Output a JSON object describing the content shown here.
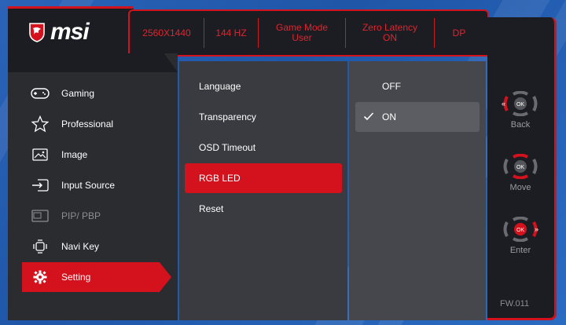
{
  "header": {
    "brand": "msi",
    "cells": [
      {
        "line1": "2560X1440",
        "line2": ""
      },
      {
        "line1": "144 HZ",
        "line2": ""
      },
      {
        "line1": "Game Mode",
        "line2": "User"
      },
      {
        "line1": "Zero Latency",
        "line2": "ON"
      },
      {
        "line1": "DP",
        "line2": ""
      }
    ]
  },
  "menu": {
    "items": [
      {
        "label": "Gaming",
        "icon": "gamepad-icon",
        "state": "normal"
      },
      {
        "label": "Professional",
        "icon": "star-icon",
        "state": "normal"
      },
      {
        "label": "Image",
        "icon": "image-icon",
        "state": "normal"
      },
      {
        "label": "Input Source",
        "icon": "input-source-icon",
        "state": "normal"
      },
      {
        "label": "PIP/ PBP",
        "icon": "pip-icon",
        "state": "disabled"
      },
      {
        "label": "Navi Key",
        "icon": "navi-key-icon",
        "state": "normal"
      },
      {
        "label": "Setting",
        "icon": "gear-icon",
        "state": "active"
      }
    ]
  },
  "submenu": {
    "items": [
      {
        "label": "Language",
        "active": false
      },
      {
        "label": "Transparency",
        "active": false
      },
      {
        "label": "OSD Timeout",
        "active": false
      },
      {
        "label": "RGB LED",
        "active": true
      },
      {
        "label": "Reset",
        "active": false
      }
    ]
  },
  "options": {
    "items": [
      {
        "label": "OFF",
        "selected": false
      },
      {
        "label": "ON",
        "selected": true
      }
    ]
  },
  "nav": {
    "back": "Back",
    "move": "Move",
    "enter": "Enter",
    "ok": "OK",
    "firmware": "FW.011"
  },
  "colors": {
    "accent": "#d3121d",
    "panel_dark": "#1c1d22",
    "menu_bg": "#2b2c30",
    "submenu_bg": "#3a3b40",
    "options_bg": "#46474c"
  }
}
